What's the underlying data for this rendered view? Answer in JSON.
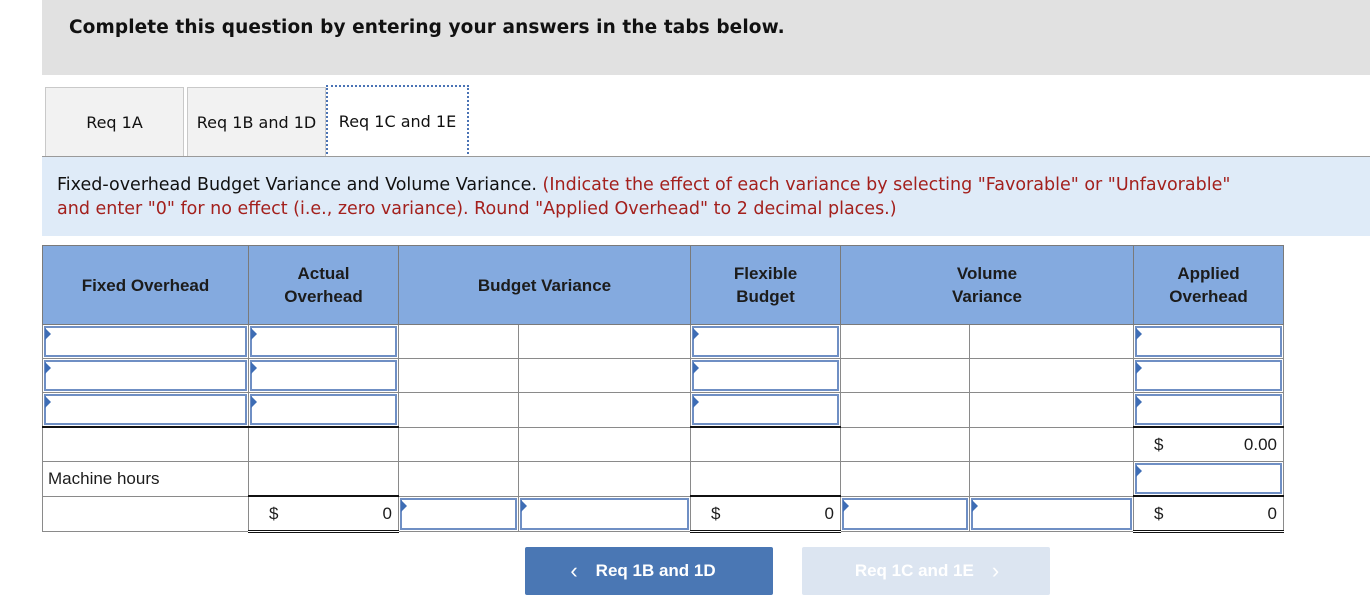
{
  "banner": {
    "text": "Complete this question by entering your answers in the tabs below."
  },
  "tabs": [
    {
      "label": "Req 1A",
      "active": false
    },
    {
      "label": "Req 1B and 1D",
      "active": false
    },
    {
      "label": "Req 1C and 1E",
      "active": true
    }
  ],
  "instructions": {
    "title": "Fixed-overhead Budget Variance and Volume Variance.",
    "note_line1": "(Indicate the effect of each variance by selecting \"Favorable\" or \"Unfavorable\"",
    "note_line2": "and enter \"0\" for no effect (i.e., zero variance). Round \"Applied Overhead\" to 2 decimal places.)"
  },
  "table": {
    "headers": {
      "fixed_overhead": "Fixed Overhead",
      "actual_overhead": "Actual Overhead",
      "budget_variance": "Budget Variance",
      "flexible_budget": "Flexible Budget",
      "volume_variance": "Volume Variance",
      "applied_overhead": "Applied Overhead"
    },
    "row4": {
      "applied_currency": "$",
      "applied_value": "0.00"
    },
    "row5": {
      "label": "Machine hours"
    },
    "totals": {
      "actual_currency": "$",
      "actual_value": "0",
      "flexible_currency": "$",
      "flexible_value": "0",
      "applied_currency": "$",
      "applied_value": "0"
    }
  },
  "nav": {
    "prev_label": "Req 1B and 1D",
    "next_label": "Req 1C and 1E",
    "prev_icon": "chevron-left-icon",
    "next_icon": "chevron-right-icon"
  }
}
